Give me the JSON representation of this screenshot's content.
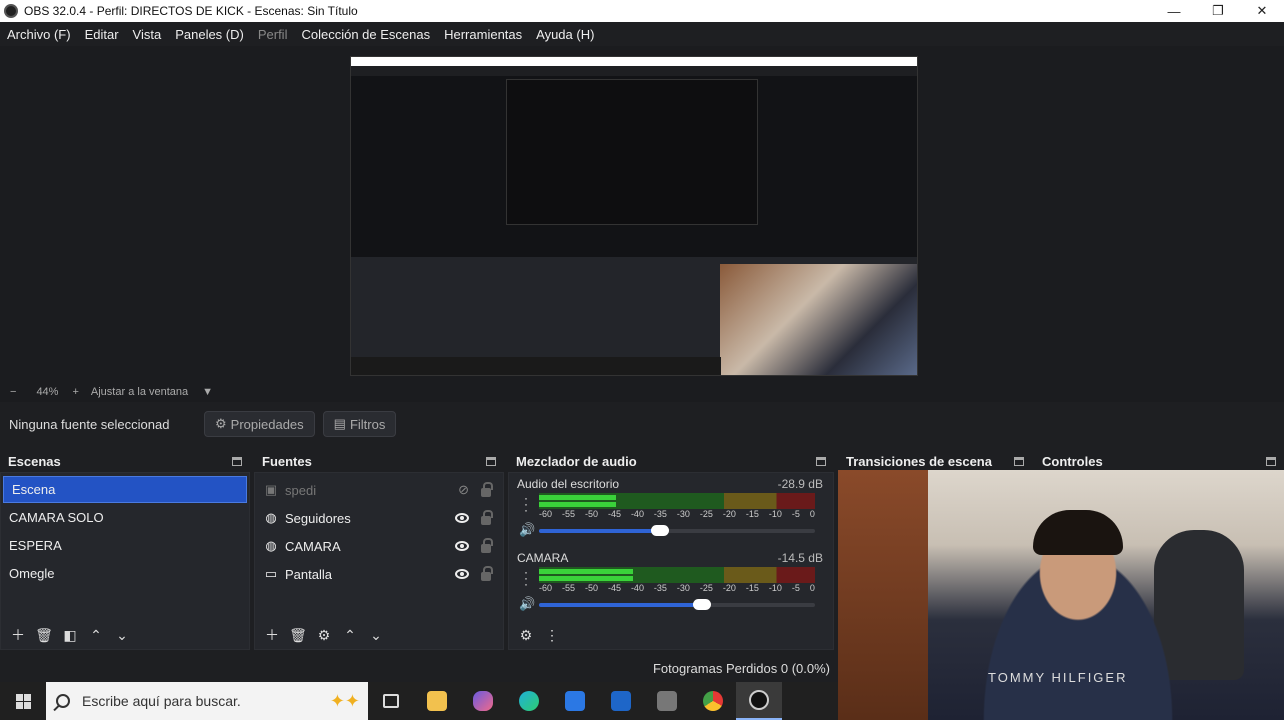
{
  "titlebar": {
    "title": "OBS 32.0.4 - Perfil: DIRECTOS DE KICK - Escenas: Sin Título"
  },
  "menu": [
    {
      "label": "Archivo (F)",
      "enabled": true
    },
    {
      "label": "Editar",
      "enabled": true
    },
    {
      "label": "Vista",
      "enabled": true
    },
    {
      "label": "Paneles (D)",
      "enabled": true
    },
    {
      "label": "Perfil",
      "enabled": false
    },
    {
      "label": "Colección de Escenas",
      "enabled": true
    },
    {
      "label": "Herramientas",
      "enabled": true
    },
    {
      "label": "Ayuda (H)",
      "enabled": true
    }
  ],
  "zoom": {
    "minus": "−",
    "level": "44%",
    "plus": "+",
    "fit": "Ajustar a la ventana",
    "arrow": "▼"
  },
  "source_bar": {
    "no_selection": "Ninguna fuente seleccionad",
    "properties": "Propiedades",
    "filters": "Filtros"
  },
  "scenes": {
    "title": "Escenas",
    "items": [
      {
        "label": "Escena",
        "selected": true
      },
      {
        "label": "CAMARA SOLO",
        "selected": false
      },
      {
        "label": "ESPERA",
        "selected": false
      },
      {
        "label": "Omegle",
        "selected": false
      }
    ]
  },
  "sources": {
    "title": "Fuentes",
    "items": [
      {
        "label": "spedi",
        "icon": "image-icon",
        "visible": false
      },
      {
        "label": "Seguidores",
        "icon": "browser-icon",
        "visible": true
      },
      {
        "label": "CAMARA",
        "icon": "browser-icon",
        "visible": true
      },
      {
        "label": "Pantalla",
        "icon": "monitor-icon",
        "visible": true
      }
    ]
  },
  "mixer": {
    "title": "Mezclador de audio",
    "channels": [
      {
        "name": "Audio del escritorio",
        "db": "-28.9 dB",
        "level": 0.28,
        "level2": 0.28,
        "fader": 0.44
      },
      {
        "name": "CAMARA",
        "db": "-14.5 dB",
        "level": 0.34,
        "level2": 0.34,
        "fader": 0.59
      }
    ],
    "scale": [
      "-60",
      "-55",
      "-50",
      "-45",
      "-40",
      "-35",
      "-30",
      "-25",
      "-20",
      "-15",
      "-10",
      "-5",
      "0"
    ]
  },
  "transitions": {
    "title": "Transiciones de escena"
  },
  "controls": {
    "title": "Controles"
  },
  "camera_overlay": {
    "shirt_text": "TOMMY HILFIGER"
  },
  "status": {
    "frames": "Fotogramas Perdidos 0 (0.0%)"
  },
  "taskbar": {
    "search_placeholder": "Escribe aquí para buscar."
  },
  "colors": {
    "accent": "#2353c4",
    "meter_green": "#3ad33a",
    "bg": "#1e1f22"
  }
}
